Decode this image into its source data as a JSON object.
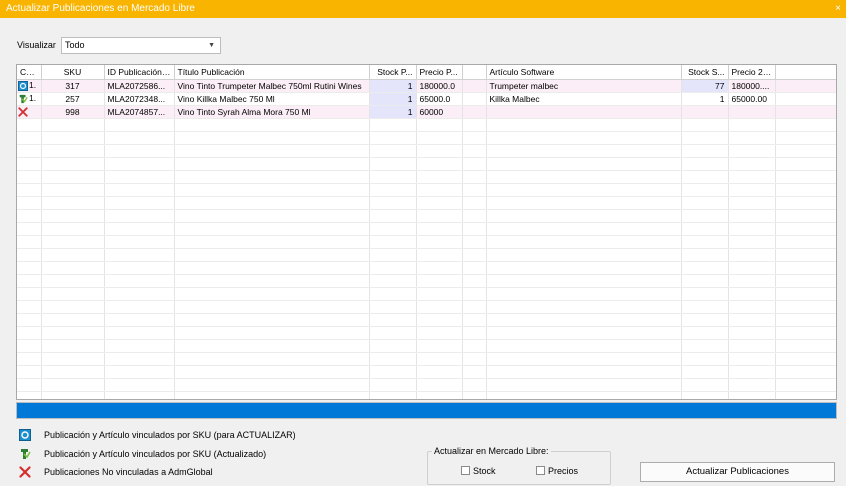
{
  "window": {
    "title": "Actualizar Publicaciones en Mercado Libre",
    "close_glyph": "×"
  },
  "filter": {
    "label": "Visualizar",
    "selected": "Todo"
  },
  "grid": {
    "columns": [
      "Có...",
      "SKU",
      "ID Publicación ...",
      "Título Publicación",
      "Stock P...",
      "Precio P...",
      "",
      "Artículo Software",
      "Stock S...",
      "Precio 2 ...",
      ""
    ],
    "rows": [
      {
        "icon": "sync-icon",
        "code": "1.",
        "sku": "317",
        "id": "MLA2072586...",
        "title": "Vino Tinto Trumpeter Malbec 750ml Rutini Wines",
        "stock_p": "1",
        "precio_p": "180000.0",
        "extra": "",
        "articulo": "Trumpeter malbec",
        "stock_s": "77",
        "precio2": "180000...."
      },
      {
        "icon": "updated-icon",
        "code": "1.",
        "sku": "257",
        "id": "MLA2072348...",
        "title": "Vino Killka Malbec  750 Ml",
        "stock_p": "1",
        "precio_p": "65000.0",
        "extra": "",
        "articulo": "Killka Malbec",
        "stock_s": "1",
        "precio2": "65000.00"
      },
      {
        "icon": "unlinked-icon",
        "code": "",
        "sku": "998",
        "id": "MLA2074857...",
        "title": "Vino Tinto Syrah Alma Mora 750 Ml",
        "stock_p": "1",
        "precio_p": "60000",
        "extra": "",
        "articulo": "",
        "stock_s": "",
        "precio2": ""
      }
    ]
  },
  "progress": {
    "fraction": 1.0,
    "color": "#0078d7"
  },
  "legend": {
    "sync": "Publicación y Artículo vinculados por SKU (para ACTUALIZAR)",
    "updated": "Publicación y Artículo vinculados por SKU (Actualizado)",
    "unlinked": "Publicaciones No vinculadas a AdmGlobal"
  },
  "update_group": {
    "title": "Actualizar en Mercado Libre:",
    "stock_label": "Stock",
    "precios_label": "Precios"
  },
  "actions": {
    "update_button": "Actualizar Publicaciones"
  },
  "colors": {
    "titlebar": "#f9b400",
    "accent": "#0078d7",
    "row_highlight": "#fceef6",
    "stock_highlight": "#e4e4fb"
  }
}
